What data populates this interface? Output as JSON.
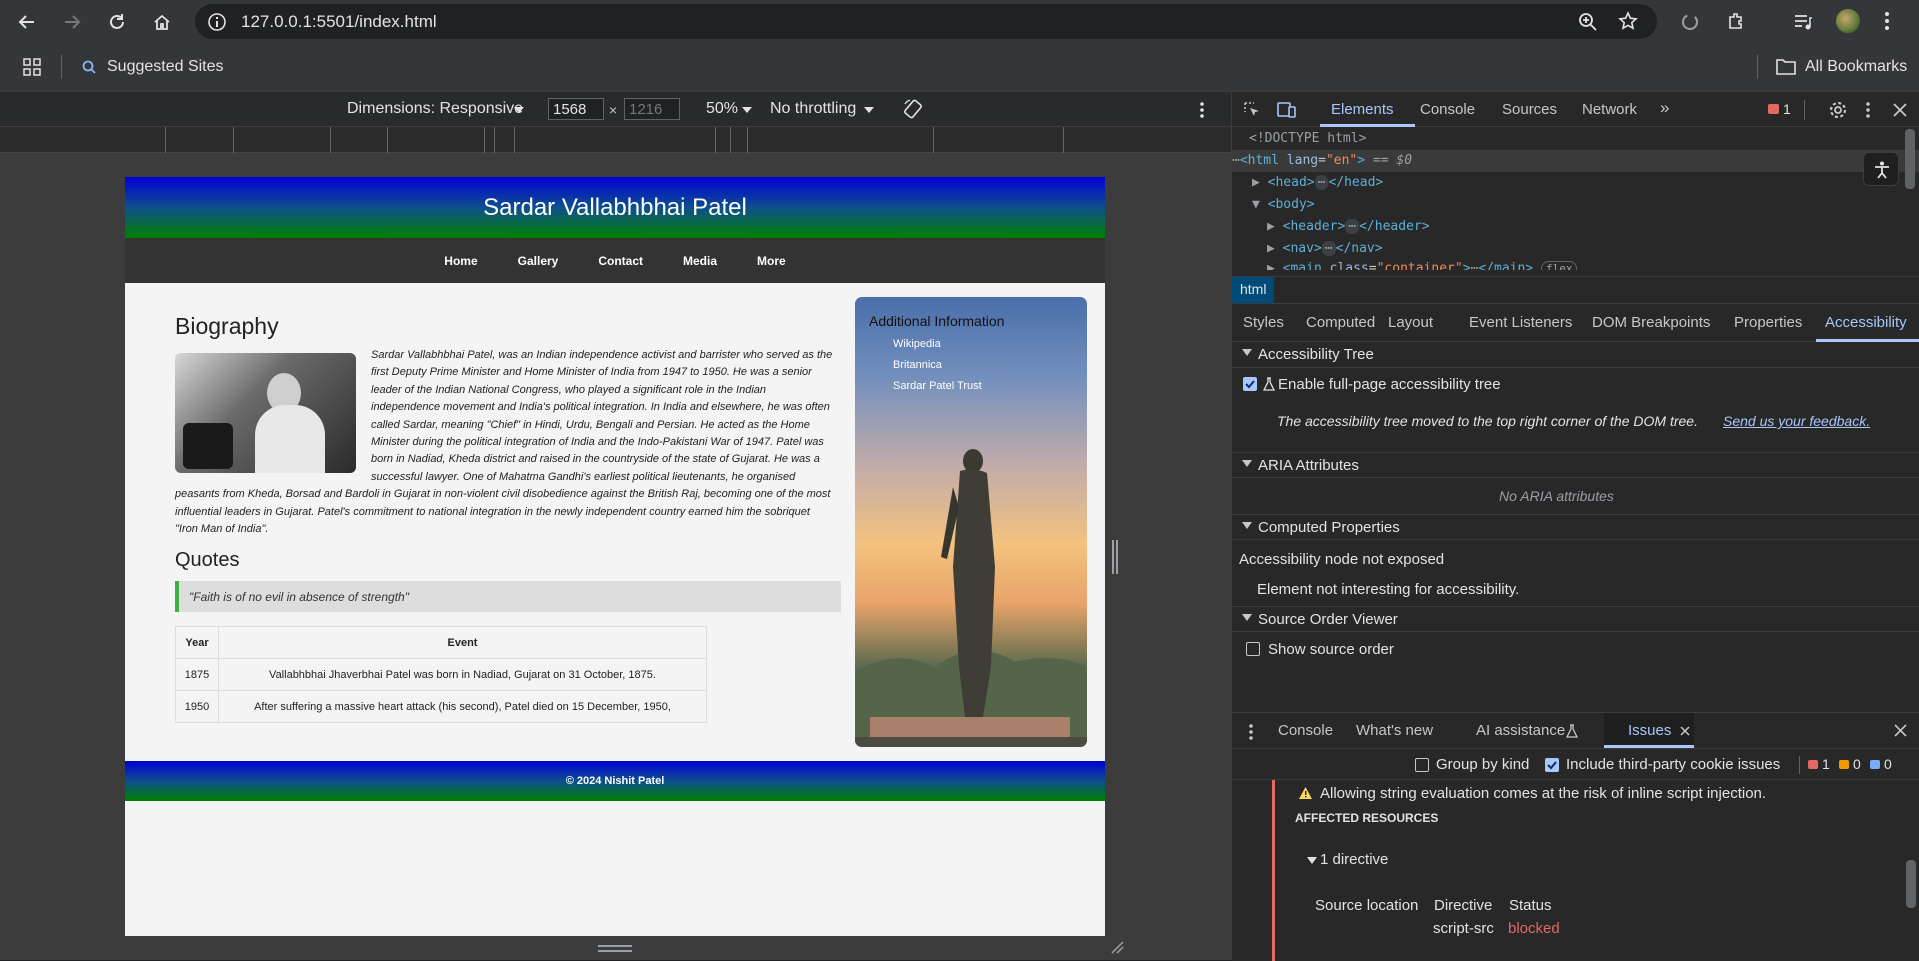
{
  "browser": {
    "url": "127.0.0.1:5501/index.html",
    "bookmarks": {
      "suggested": "Suggested Sites",
      "all": "All Bookmarks"
    }
  },
  "device_toolbar": {
    "dimensions": "Dimensions: Responsive",
    "width": "1568",
    "height_placeholder": "1216",
    "zoom": "50%",
    "throttling": "No throttling"
  },
  "site": {
    "title": "Sardar Vallabhbhai Patel",
    "nav": [
      "Home",
      "Gallery",
      "Contact",
      "Media",
      "More"
    ],
    "bio_heading": "Biography",
    "bio_text": "Sardar Vallabhbhai Patel, was an Indian independence activist and barrister who served as the first Deputy Prime Minister and Home Minister of India from 1947 to 1950. He was a senior leader of the Indian National Congress, who played a significant role in the Indian independence movement and India's political integration. In India and elsewhere, he was often called Sardar, meaning \"Chief\" in Hindi, Urdu, Bengali and Persian. He acted as the Home Minister during the political integration of India and the Indo-Pakistani War of 1947. Patel was born in Nadiad, Kheda district and raised in the countryside of the state of Gujarat. He was a successful lawyer. One of Mahatma Gandhi's earliest political lieutenants, he organised peasants from Kheda, Borsad and Bardoli in Gujarat in non-violent civil disobedience against the British Raj, becoming one of the most influential leaders in Gujarat. Patel's commitment to national integration in the newly independent country earned him the sobriquet \"Iron Man of India\".",
    "quotes_heading": "Quotes",
    "quote": "\"Faith is of no evil in absence of strength\"",
    "table": {
      "headers": [
        "Year",
        "Event"
      ],
      "rows": [
        [
          "1875",
          "Vallabhbhai Jhaverbhai Patel was born in Nadiad, Gujarat on 31 October, 1875."
        ],
        [
          "1950",
          "After suffering a massive heart attack (his second), Patel died on 15 December, 1950,"
        ]
      ]
    },
    "aside": {
      "title": "Additional Information",
      "links": [
        "Wikipedia",
        "Britannica",
        "Sardar Patel Trust"
      ]
    },
    "footer": "© 2024 Nishit Patel"
  },
  "devtools": {
    "tabs": [
      "Elements",
      "Console",
      "Sources",
      "Network"
    ],
    "error_count": "1",
    "dom": {
      "doctype": "<!DOCTYPE html>",
      "html_tag": "<html",
      "html_attr": "lang",
      "html_val": "\"en\"",
      "html_close": ">",
      "html_suffix": "== $0",
      "head": "<head>",
      "head_close": "</head>",
      "body": "<body>",
      "header": "<header>",
      "header_close": "</header>",
      "nav": "<nav>",
      "nav_close": "</nav>",
      "main": "<main",
      "main_attr": "class",
      "main_val": "\"container\"",
      "main_open_end": ">",
      "main_close": "</main>",
      "flex_badge": "flex",
      "ellipsis": "⋯"
    },
    "breadcrumb": "html",
    "side_tabs": [
      "Styles",
      "Computed",
      "Layout",
      "Event Listeners",
      "DOM Breakpoints",
      "Properties",
      "Accessibility"
    ],
    "accessibility": {
      "tree_heading": "Accessibility Tree",
      "enable_tree": "Enable full-page accessibility tree",
      "moved_note": "The accessibility tree moved to the top right corner of the DOM tree.",
      "feedback_link": "Send us your feedback.",
      "aria_heading": "ARIA Attributes",
      "no_aria": "No ARIA attributes",
      "computed_heading": "Computed Properties",
      "not_exposed": "Accessibility node not exposed",
      "not_interesting": "Element not interesting for accessibility.",
      "source_order_heading": "Source Order Viewer",
      "show_source_order": "Show source order"
    },
    "drawer": {
      "tabs": [
        "Console",
        "What's new",
        "AI assistance",
        "Issues"
      ],
      "group_by_kind": "Group by kind",
      "include_third_party": "Include third-party cookie issues",
      "counts": {
        "errors": "1",
        "warnings": "0",
        "info": "0"
      },
      "issue_text": "Allowing string evaluation comes at the risk of inline script injection.",
      "affected_resources": "AFFECTED RESOURCES",
      "directive_count": "1 directive",
      "columns": [
        "Source location",
        "Directive",
        "Status"
      ],
      "directive": "script-src",
      "status": "blocked"
    }
  },
  "colors": {
    "accent": "#a8c7fa",
    "error": "#e46962",
    "header_gradient_top": "#0000d8",
    "header_gradient_bottom": "#008000"
  }
}
